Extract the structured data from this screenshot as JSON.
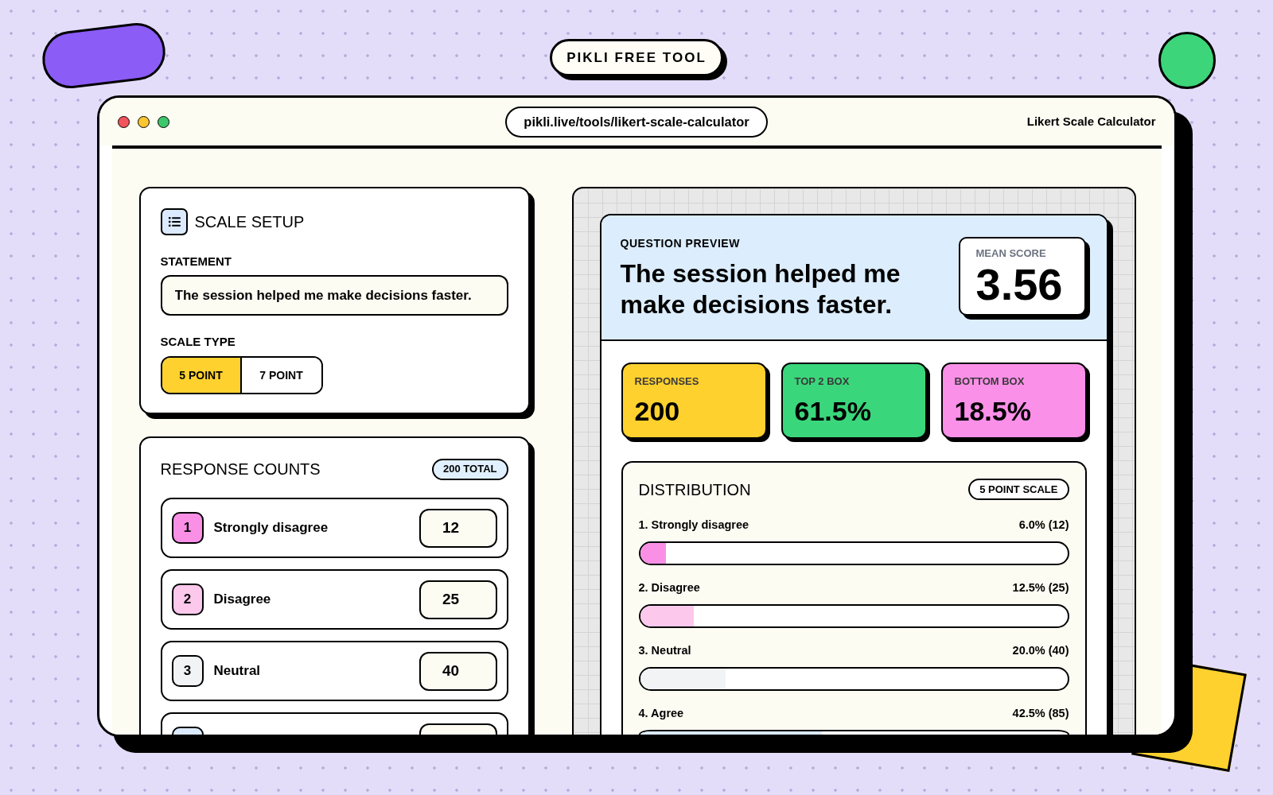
{
  "header_badge": "PIKLI FREE TOOL",
  "window": {
    "address": "pikli.live/tools/likert-scale-calculator",
    "title": "Likert Scale Calculator"
  },
  "scale_setup": {
    "title": "SCALE SETUP",
    "statement_label": "STATEMENT",
    "statement": "The session helped me make decisions faster.",
    "scale_type_label": "SCALE TYPE",
    "scale_options": [
      {
        "label": "5 POINT",
        "selected": true
      },
      {
        "label": "7 POINT",
        "selected": false
      }
    ]
  },
  "response_counts": {
    "title": "RESPONSE COUNTS",
    "total": "200 TOTAL",
    "rows": [
      {
        "number": "1",
        "label": "Strongly disagree",
        "count": "12",
        "color": "#f990e6"
      },
      {
        "number": "2",
        "label": "Disagree",
        "count": "25",
        "color": "#fcc8ec"
      },
      {
        "number": "3",
        "label": "Neutral",
        "count": "40",
        "color": "#f1f3f5"
      },
      {
        "color": "#dbeafe"
      }
    ]
  },
  "preview": {
    "label": "QUESTION PREVIEW",
    "statement": "The session helped me make decisions faster.",
    "mean_label": "MEAN SCORE",
    "mean": "3.56",
    "stats": [
      {
        "label": "RESPONSES",
        "value": "200",
        "color": "#ffd12e"
      },
      {
        "label": "TOP 2 BOX",
        "value": "61.5%",
        "color": "#3ad67b"
      },
      {
        "label": "BOTTOM BOX",
        "value": "18.5%",
        "color": "#fb90e9"
      }
    ],
    "distribution": {
      "title": "DISTRIBUTION",
      "scale": "5 POINT SCALE",
      "rows": [
        {
          "label": "1. Strongly disagree",
          "reading": "6.0% (12)",
          "level": 0.06,
          "color": "#f990e6"
        },
        {
          "label": "2. Disagree",
          "reading": "12.5% (25)",
          "level": 0.125,
          "color": "#fcc8ec"
        },
        {
          "label": "3. Neutral",
          "reading": "20.0% (40)",
          "level": 0.2,
          "color": "#f1f3f5"
        },
        {
          "label": "4. Agree",
          "reading": "42.5% (85)",
          "level": 0.425,
          "color": "#dbeafe"
        }
      ]
    }
  }
}
